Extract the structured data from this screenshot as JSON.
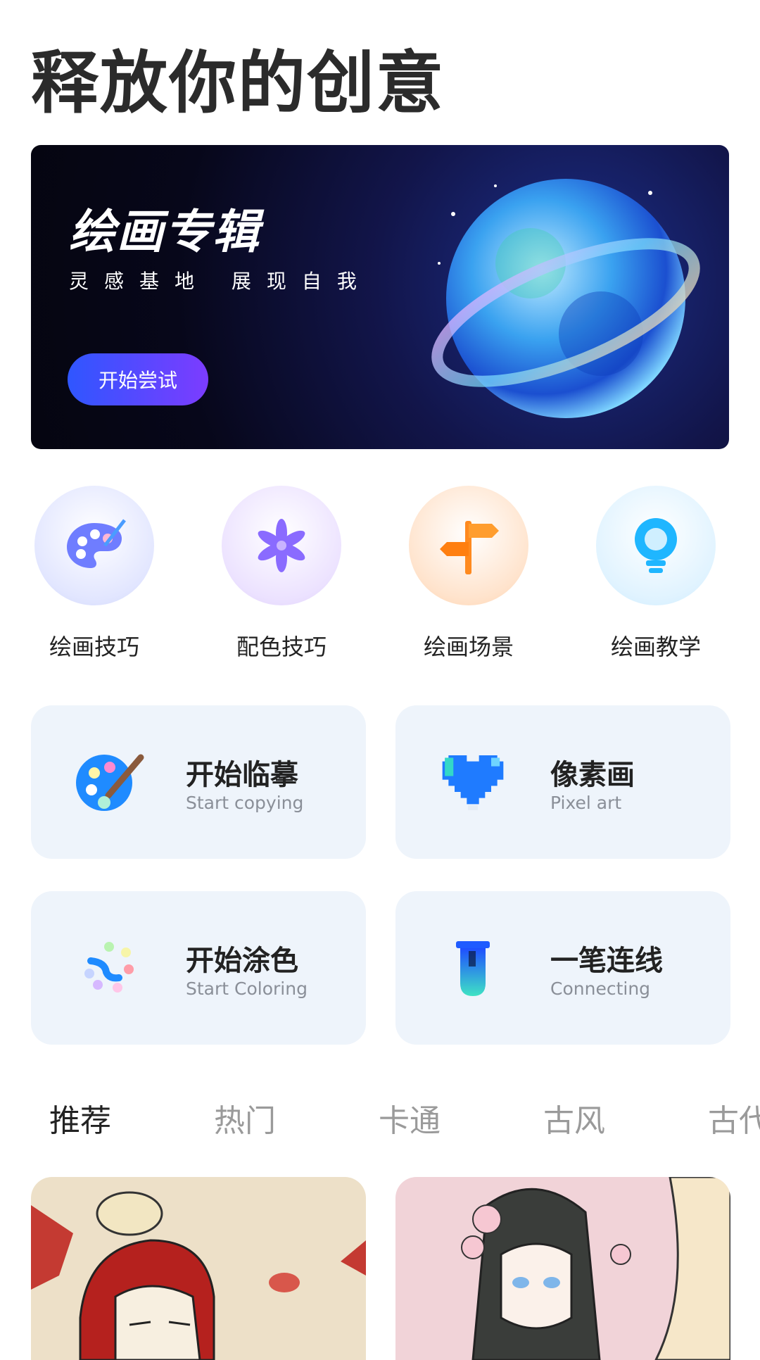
{
  "page": {
    "title": "释放你的创意"
  },
  "banner": {
    "title": "绘画专辑",
    "subtitle": "灵感基地  展现自我",
    "cta_label": "开始尝试"
  },
  "categories": [
    {
      "label": "绘画技巧",
      "icon": "palette-icon"
    },
    {
      "label": "配色技巧",
      "icon": "flower-icon"
    },
    {
      "label": "绘画场景",
      "icon": "signpost-icon"
    },
    {
      "label": "绘画教学",
      "icon": "lightbulb-icon"
    }
  ],
  "features": [
    {
      "title": "开始临摹",
      "subtitle": "Start copying",
      "icon": "palette-brush-icon"
    },
    {
      "title": "像素画",
      "subtitle": "Pixel art",
      "icon": "pixel-heart-icon"
    },
    {
      "title": "开始涂色",
      "subtitle": "Start Coloring",
      "icon": "color-dots-icon"
    },
    {
      "title": "一笔连线",
      "subtitle": "Connecting",
      "icon": "test-tube-icon"
    }
  ],
  "tabs": [
    {
      "label": "推荐",
      "active": true
    },
    {
      "label": "热门",
      "active": false
    },
    {
      "label": "卡通",
      "active": false
    },
    {
      "label": "古风",
      "active": false
    },
    {
      "label": "古代",
      "active": false
    }
  ],
  "colors": {
    "banner_button_start": "#2f56ff",
    "banner_button_end": "#7c3cff",
    "card_bg": "#eef4fb",
    "tab_active": "#222222",
    "tab_inactive": "#9a9a9a"
  }
}
